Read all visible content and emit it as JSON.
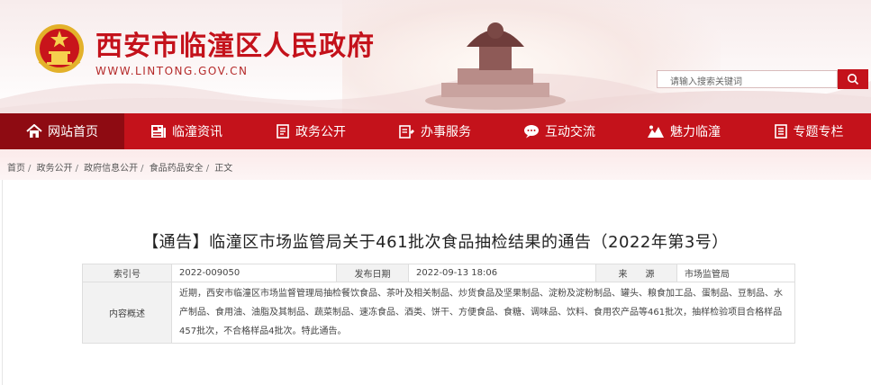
{
  "header": {
    "site_title": "西安市临潼区人民政府",
    "site_url": "WWW.LINTONG.GOV.CN",
    "search_placeholder": "请输入搜索关键词",
    "brand_color": "#c4121b"
  },
  "nav": {
    "items": [
      {
        "label": "网站首页",
        "icon": "home-icon",
        "active": true
      },
      {
        "label": "临潼资讯",
        "icon": "news-icon"
      },
      {
        "label": "政务公开",
        "icon": "document-icon"
      },
      {
        "label": "办事服务",
        "icon": "service-icon"
      },
      {
        "label": "互动交流",
        "icon": "chat-icon"
      },
      {
        "label": "魅力临潼",
        "icon": "scenery-icon"
      },
      {
        "label": "专题专栏",
        "icon": "list-icon"
      }
    ]
  },
  "breadcrumb": [
    "首页",
    "政务公开",
    "政府信息公开",
    "食品药品安全",
    "正文"
  ],
  "article": {
    "title": "【通告】临潼区市场监管局关于461批次食品抽检结果的通告（2022年第3号）",
    "meta": {
      "index_label": "索引号",
      "index_value": "2022-009050",
      "date_label": "发布日期",
      "date_value": "2022-09-13 18:06",
      "source_label": "来　　源",
      "source_value": "市场监管局",
      "summary_label": "内容概述",
      "summary_value": "近期，西安市临潼区市场监督管理局抽检餐饮食品、茶叶及相关制品、炒货食品及坚果制品、淀粉及淀粉制品、罐头、粮食加工品、蛋制品、豆制品、水产制品、食用油、油脂及其制品、蔬菜制品、速冻食品、酒类、饼干、方便食品、食糖、调味品、饮料、食用农产品等461批次，抽样检验项目合格样品457批次，不合格样品4批次。特此通告。"
    }
  }
}
